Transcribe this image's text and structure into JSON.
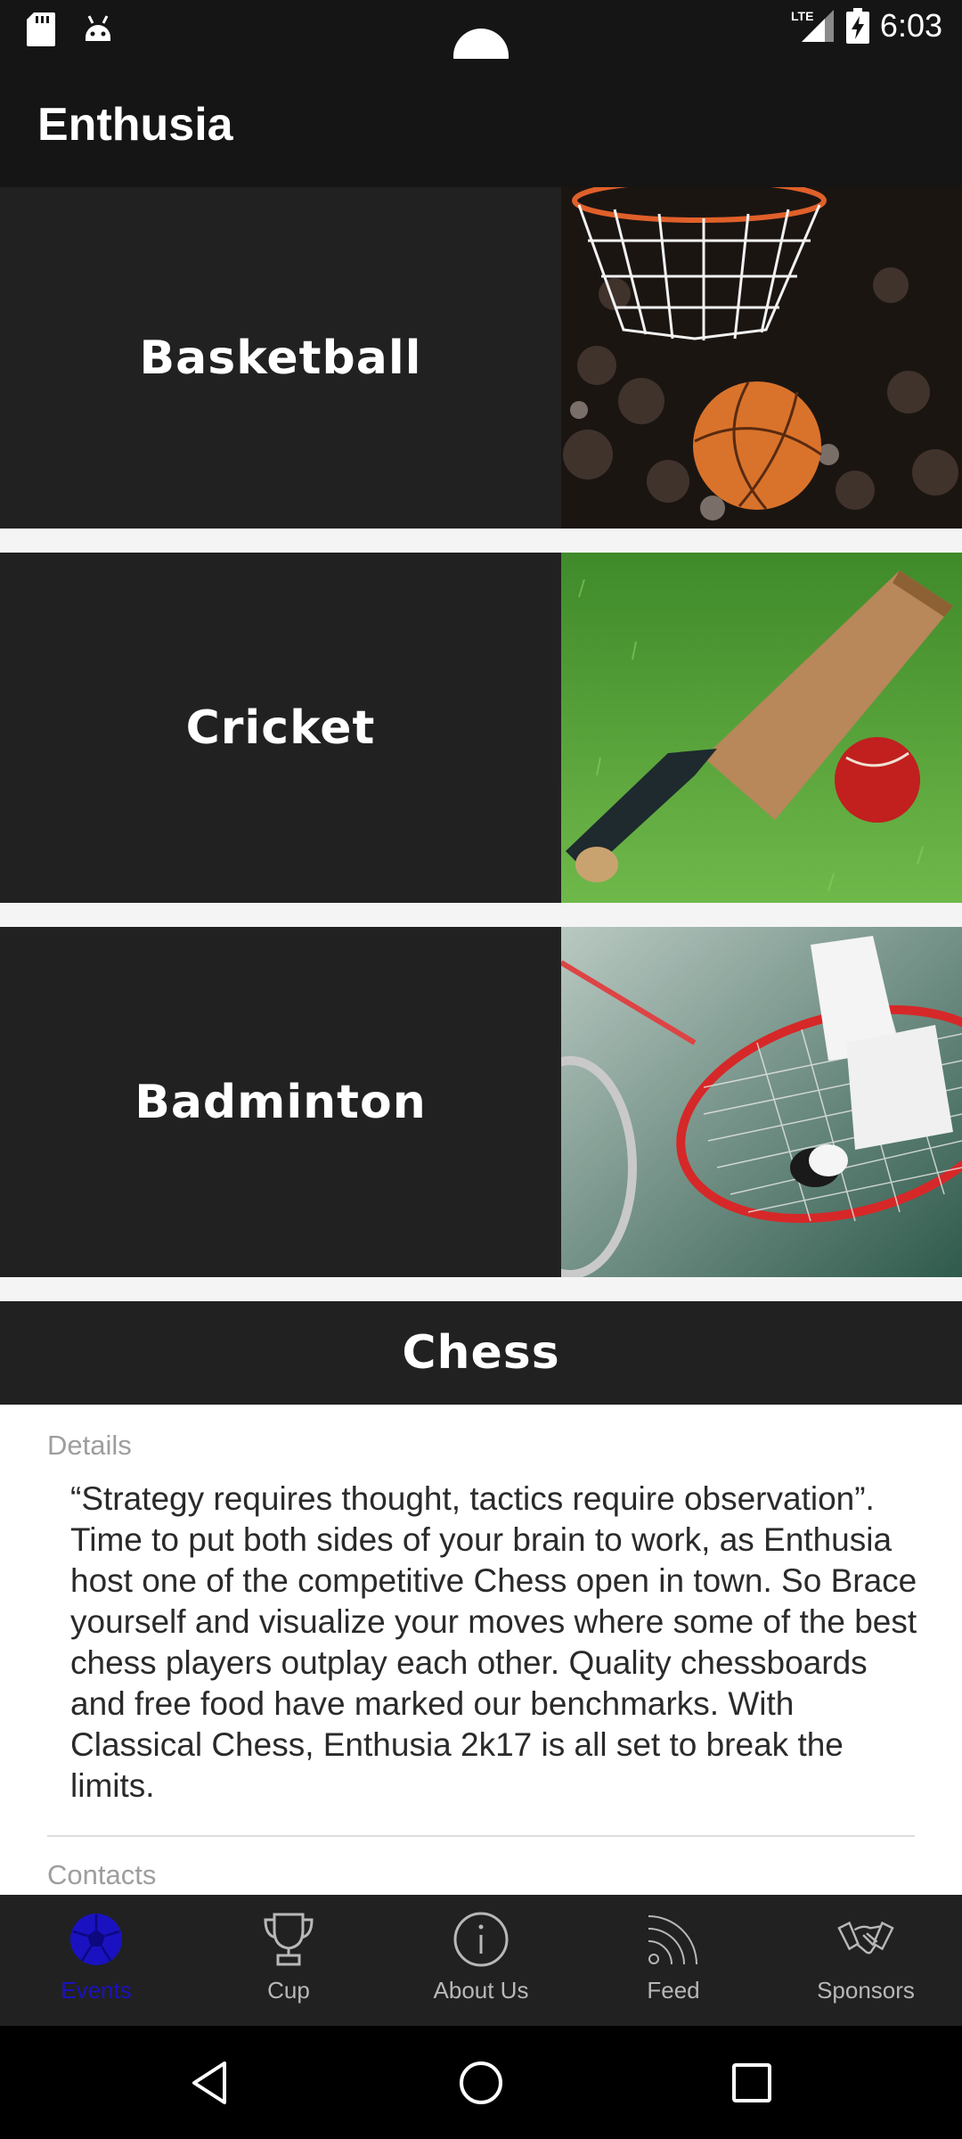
{
  "status_bar": {
    "time": "6:03",
    "network": "LTE"
  },
  "app_bar": {
    "title": "Enthusia"
  },
  "events": [
    {
      "label": "Basketball",
      "image": "basketball-hoop-image"
    },
    {
      "label": "Cricket",
      "image": "cricket-bat-ball-image"
    },
    {
      "label": "Badminton",
      "image": "badminton-racket-shuttlecock-image"
    }
  ],
  "chess": {
    "title": "Chess",
    "details_label": "Details",
    "details_text": "“Strategy requires thought, tactics require observation”. Time to put both sides of your brain to work, as Enthusia host one of the competitive Chess open in town. So Brace yourself and visualize your moves where some of the best chess players outplay each other. Quality chessboards and free food have marked our benchmarks. With Classical Chess, Enthusia 2k17 is all set to break the limits.",
    "contacts_label": "Contacts"
  },
  "bottom_nav": {
    "items": [
      {
        "label": "Events",
        "icon": "soccer-ball-icon",
        "active": true
      },
      {
        "label": "Cup",
        "icon": "trophy-icon",
        "active": false
      },
      {
        "label": "About Us",
        "icon": "info-icon",
        "active": false
      },
      {
        "label": "Feed",
        "icon": "rss-feed-icon",
        "active": false
      },
      {
        "label": "Sponsors",
        "icon": "handshake-icon",
        "active": false
      }
    ]
  },
  "colors": {
    "bar_dark": "#151515",
    "card_dark": "#212121",
    "active_tab": "#1a12c0",
    "inactive_tab": "#b8b8b8"
  }
}
